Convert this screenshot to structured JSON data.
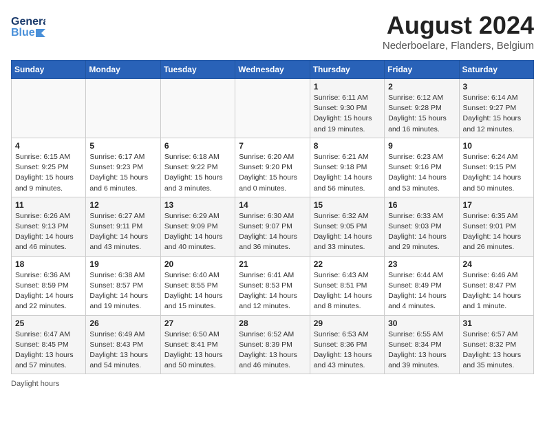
{
  "header": {
    "logo_general": "General",
    "logo_blue": "Blue",
    "month_year": "August 2024",
    "location": "Nederboelare, Flanders, Belgium"
  },
  "days_of_week": [
    "Sunday",
    "Monday",
    "Tuesday",
    "Wednesday",
    "Thursday",
    "Friday",
    "Saturday"
  ],
  "weeks": [
    [
      {
        "day": "",
        "info": ""
      },
      {
        "day": "",
        "info": ""
      },
      {
        "day": "",
        "info": ""
      },
      {
        "day": "",
        "info": ""
      },
      {
        "day": "1",
        "info": "Sunrise: 6:11 AM\nSunset: 9:30 PM\nDaylight: 15 hours\nand 19 minutes."
      },
      {
        "day": "2",
        "info": "Sunrise: 6:12 AM\nSunset: 9:28 PM\nDaylight: 15 hours\nand 16 minutes."
      },
      {
        "day": "3",
        "info": "Sunrise: 6:14 AM\nSunset: 9:27 PM\nDaylight: 15 hours\nand 12 minutes."
      }
    ],
    [
      {
        "day": "4",
        "info": "Sunrise: 6:15 AM\nSunset: 9:25 PM\nDaylight: 15 hours\nand 9 minutes."
      },
      {
        "day": "5",
        "info": "Sunrise: 6:17 AM\nSunset: 9:23 PM\nDaylight: 15 hours\nand 6 minutes."
      },
      {
        "day": "6",
        "info": "Sunrise: 6:18 AM\nSunset: 9:22 PM\nDaylight: 15 hours\nand 3 minutes."
      },
      {
        "day": "7",
        "info": "Sunrise: 6:20 AM\nSunset: 9:20 PM\nDaylight: 15 hours\nand 0 minutes."
      },
      {
        "day": "8",
        "info": "Sunrise: 6:21 AM\nSunset: 9:18 PM\nDaylight: 14 hours\nand 56 minutes."
      },
      {
        "day": "9",
        "info": "Sunrise: 6:23 AM\nSunset: 9:16 PM\nDaylight: 14 hours\nand 53 minutes."
      },
      {
        "day": "10",
        "info": "Sunrise: 6:24 AM\nSunset: 9:15 PM\nDaylight: 14 hours\nand 50 minutes."
      }
    ],
    [
      {
        "day": "11",
        "info": "Sunrise: 6:26 AM\nSunset: 9:13 PM\nDaylight: 14 hours\nand 46 minutes."
      },
      {
        "day": "12",
        "info": "Sunrise: 6:27 AM\nSunset: 9:11 PM\nDaylight: 14 hours\nand 43 minutes."
      },
      {
        "day": "13",
        "info": "Sunrise: 6:29 AM\nSunset: 9:09 PM\nDaylight: 14 hours\nand 40 minutes."
      },
      {
        "day": "14",
        "info": "Sunrise: 6:30 AM\nSunset: 9:07 PM\nDaylight: 14 hours\nand 36 minutes."
      },
      {
        "day": "15",
        "info": "Sunrise: 6:32 AM\nSunset: 9:05 PM\nDaylight: 14 hours\nand 33 minutes."
      },
      {
        "day": "16",
        "info": "Sunrise: 6:33 AM\nSunset: 9:03 PM\nDaylight: 14 hours\nand 29 minutes."
      },
      {
        "day": "17",
        "info": "Sunrise: 6:35 AM\nSunset: 9:01 PM\nDaylight: 14 hours\nand 26 minutes."
      }
    ],
    [
      {
        "day": "18",
        "info": "Sunrise: 6:36 AM\nSunset: 8:59 PM\nDaylight: 14 hours\nand 22 minutes."
      },
      {
        "day": "19",
        "info": "Sunrise: 6:38 AM\nSunset: 8:57 PM\nDaylight: 14 hours\nand 19 minutes."
      },
      {
        "day": "20",
        "info": "Sunrise: 6:40 AM\nSunset: 8:55 PM\nDaylight: 14 hours\nand 15 minutes."
      },
      {
        "day": "21",
        "info": "Sunrise: 6:41 AM\nSunset: 8:53 PM\nDaylight: 14 hours\nand 12 minutes."
      },
      {
        "day": "22",
        "info": "Sunrise: 6:43 AM\nSunset: 8:51 PM\nDaylight: 14 hours\nand 8 minutes."
      },
      {
        "day": "23",
        "info": "Sunrise: 6:44 AM\nSunset: 8:49 PM\nDaylight: 14 hours\nand 4 minutes."
      },
      {
        "day": "24",
        "info": "Sunrise: 6:46 AM\nSunset: 8:47 PM\nDaylight: 14 hours\nand 1 minute."
      }
    ],
    [
      {
        "day": "25",
        "info": "Sunrise: 6:47 AM\nSunset: 8:45 PM\nDaylight: 13 hours\nand 57 minutes."
      },
      {
        "day": "26",
        "info": "Sunrise: 6:49 AM\nSunset: 8:43 PM\nDaylight: 13 hours\nand 54 minutes."
      },
      {
        "day": "27",
        "info": "Sunrise: 6:50 AM\nSunset: 8:41 PM\nDaylight: 13 hours\nand 50 minutes."
      },
      {
        "day": "28",
        "info": "Sunrise: 6:52 AM\nSunset: 8:39 PM\nDaylight: 13 hours\nand 46 minutes."
      },
      {
        "day": "29",
        "info": "Sunrise: 6:53 AM\nSunset: 8:36 PM\nDaylight: 13 hours\nand 43 minutes."
      },
      {
        "day": "30",
        "info": "Sunrise: 6:55 AM\nSunset: 8:34 PM\nDaylight: 13 hours\nand 39 minutes."
      },
      {
        "day": "31",
        "info": "Sunrise: 6:57 AM\nSunset: 8:32 PM\nDaylight: 13 hours\nand 35 minutes."
      }
    ]
  ],
  "footer": {
    "note": "Daylight hours"
  }
}
